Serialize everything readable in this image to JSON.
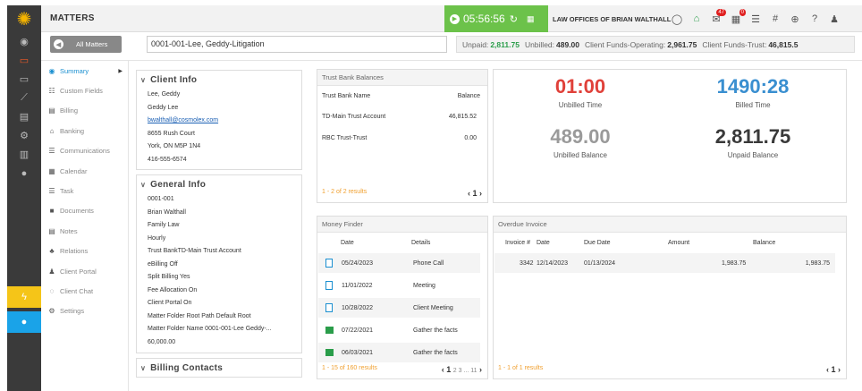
{
  "header": {
    "title": "MATTERS",
    "timer": "05:56:56",
    "firm": "LAW OFFICES OF BRIAN WALTHALL",
    "mail_badge": "47",
    "cal_badge": "0"
  },
  "bar2": {
    "all_matters": "All Matters",
    "matter_name": "0001-001-Lee, Geddy-Litigation",
    "unpaid_label": "Unpaid:",
    "unpaid": "2,811.75",
    "unbilled_label": "Unbilled:",
    "unbilled": "489.00",
    "cfo_label": "Client Funds-Operating:",
    "cfo": "2,961.75",
    "cft_label": "Client Funds-Trust:",
    "cft": "46,815.5"
  },
  "nav": [
    {
      "icon": "dashboard-icon",
      "label": "Summary"
    },
    {
      "icon": "list-icon",
      "label": "Custom Fields"
    },
    {
      "icon": "billing-icon",
      "label": "Billing"
    },
    {
      "icon": "bank-icon",
      "label": "Banking"
    },
    {
      "icon": "communications-icon",
      "label": "Communications"
    },
    {
      "icon": "calendar-icon",
      "label": "Calendar"
    },
    {
      "icon": "task-icon",
      "label": "Task"
    },
    {
      "icon": "folder-icon",
      "label": "Documents"
    },
    {
      "icon": "notes-icon",
      "label": "Notes"
    },
    {
      "icon": "relations-icon",
      "label": "Relations"
    },
    {
      "icon": "client-portal-icon",
      "label": "Client Portal"
    },
    {
      "icon": "client-chat-icon",
      "label": "Client Chat"
    },
    {
      "icon": "settings-icon",
      "label": "Settings"
    }
  ],
  "client_info": {
    "heading": "Client Info",
    "name": "Lee, Geddy",
    "contact": "Geddy Lee",
    "email": "bwalthall@cosmolex.com",
    "street": "8655 Rush Court",
    "city": "York, ON M5P 1N4",
    "phone": "416-555-6574"
  },
  "general_info": {
    "heading": "General Info",
    "rows": [
      "0001-001",
      "Brian Walthall",
      "Family Law",
      "Hourly",
      "Trust BankTD-Main Trust Account",
      "eBilling Off",
      "Split Billing Yes",
      "Fee Allocation On",
      "Client Portal On",
      "Matter Folder Root Path Default Root",
      "Matter Folder Name 0001-001-Lee Geddy-...",
      "60,000.00"
    ]
  },
  "billing_contacts": {
    "heading": "Billing Contacts"
  },
  "trust": {
    "heading": "Trust Bank Balances",
    "col_name": "Trust Bank Name",
    "col_balance": "Balance",
    "rows": [
      {
        "name": "TD-Main Trust Account",
        "balance": "46,815.52"
      },
      {
        "name": "RBC Trust-Trust",
        "balance": "0.00"
      }
    ],
    "pager_text": "1 - 2 of 2 results",
    "page": "1"
  },
  "stats": {
    "unbilled_time": "01:00",
    "unbilled_time_label": "Unbilled Time",
    "billed_time": "1490:28",
    "billed_time_label": "Billed Time",
    "unbilled_balance": "489.00",
    "unbilled_balance_label": "Unbilled Balance",
    "unpaid_balance": "2,811.75",
    "unpaid_balance_label": "Unpaid Balance"
  },
  "money_finder": {
    "heading": "Money Finder",
    "col_date": "Date",
    "col_details": "Details",
    "rows": [
      {
        "date": "05/24/2023",
        "details": "Phone Call",
        "kind": "doc"
      },
      {
        "date": "11/01/2022",
        "details": "Meeting",
        "kind": "doc"
      },
      {
        "date": "10/28/2022",
        "details": "Client Meeting",
        "kind": "doc"
      },
      {
        "date": "07/22/2021",
        "details": "Gather the facts",
        "kind": "sheet"
      },
      {
        "date": "06/03/2021",
        "details": "Gather the facts",
        "kind": "sheet"
      }
    ],
    "pager_text": "1 - 15 of 160 results",
    "page": "1",
    "more_pages": "2 3 ... 11"
  },
  "overdue": {
    "heading": "Overdue Invoice",
    "col_invoice": "Invoice #",
    "col_date": "Date",
    "col_due": "Due Date",
    "col_amount": "Amount",
    "col_balance": "Balance",
    "row": {
      "invoice": "3342",
      "date": "12/14/2023",
      "due": "01/13/2024",
      "amount": "1,983.75",
      "balance": "1,983.75"
    },
    "pager_text": "1 - 1 of 1 results",
    "page": "1"
  },
  "colors": {
    "timer_green": "#6cc24a",
    "unbilled_time_red": "#e0413a",
    "billed_time_blue": "#3a8fd0",
    "unbilled_balance_gray": "#9a9a9a",
    "unpaid_balance_dark": "#3a3a3a"
  }
}
